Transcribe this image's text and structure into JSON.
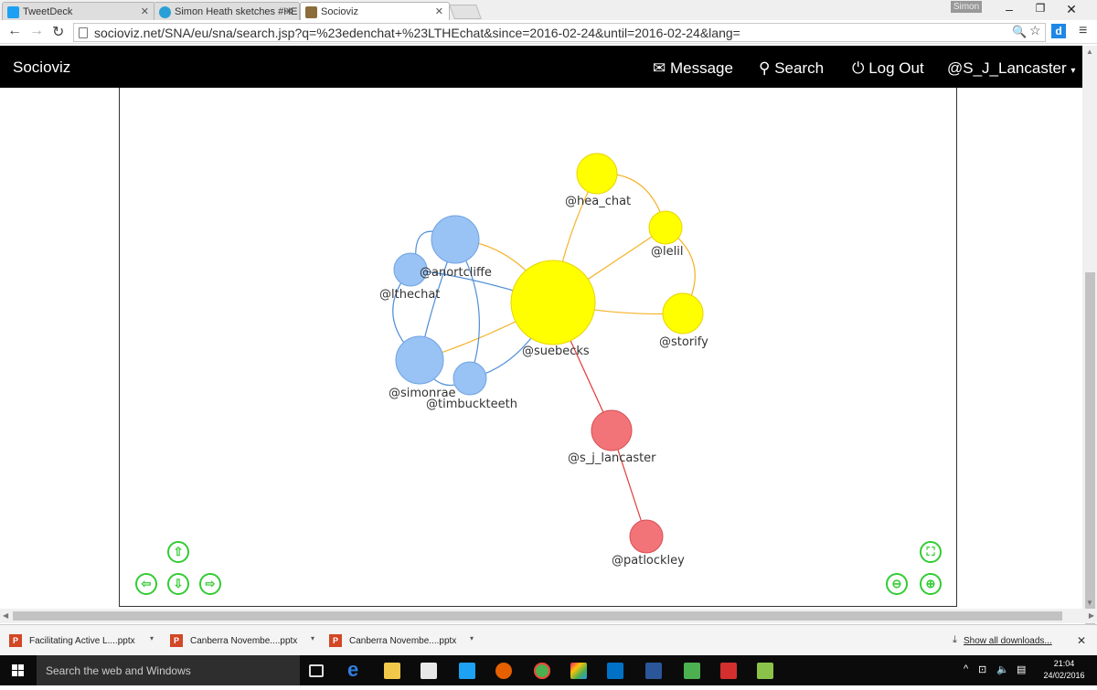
{
  "browser": {
    "tabs": [
      {
        "label": "TweetDeck",
        "color": "#1da1f2"
      },
      {
        "label": "Simon Heath sketches #HE",
        "color": "#2a9fd6"
      },
      {
        "label": "Socioviz",
        "color": "#8a6d3b"
      }
    ],
    "profile_name": "Simon",
    "url": "socioviz.net/SNA/eu/sna/search.jsp?q=%23edenchat+%23LTHEchat&since=2016-02-24&until=2016-02-24&lang="
  },
  "app": {
    "brand": "Socioviz",
    "nav": {
      "message": "Message",
      "search": "Search",
      "logout": "Log Out",
      "user": "@S_J_Lancaster"
    }
  },
  "graph": {
    "nodes": [
      {
        "id": "hea_chat",
        "label": "@hea_chat",
        "color": "#ffff00",
        "group": "yellow"
      },
      {
        "id": "lelil",
        "label": "@lelil",
        "color": "#ffff00",
        "group": "yellow"
      },
      {
        "id": "suebecks",
        "label": "@suebecks",
        "color": "#ffff00",
        "group": "yellow"
      },
      {
        "id": "storify",
        "label": "@storify",
        "color": "#ffff00",
        "group": "yellow"
      },
      {
        "id": "anortcliffe",
        "label": "@anortcliffe",
        "color": "#99c2f5",
        "group": "blue"
      },
      {
        "id": "lthechat",
        "label": "@lthechat",
        "color": "#99c2f5",
        "group": "blue"
      },
      {
        "id": "simonrae",
        "label": "@simonrae",
        "color": "#99c2f5",
        "group": "blue"
      },
      {
        "id": "timbuckteeth",
        "label": "@timbuckteeth",
        "color": "#99c2f5",
        "group": "blue"
      },
      {
        "id": "s_j_lancaster",
        "label": "@s_j_lancaster",
        "color": "#f27478",
        "group": "red"
      },
      {
        "id": "patlockley",
        "label": "@patlockley",
        "color": "#f27478",
        "group": "red"
      }
    ],
    "edge_colors": {
      "yellow": "#f5b32a",
      "blue": "#4f8fd6",
      "red": "#e33b3b"
    }
  },
  "controls": {
    "pan_up": "up-arrow-icon",
    "pan_left": "left-arrow-icon",
    "pan_down": "down-arrow-icon",
    "pan_right": "right-arrow-icon",
    "fit": "fit-screen-icon",
    "zoom_out": "minus-icon",
    "zoom_in": "plus-icon",
    "color": "#33cc33"
  },
  "downloads": {
    "items": [
      "Facilitating Active L....pptx",
      "Canberra Novembe....pptx",
      "Canberra Novembe....pptx"
    ],
    "show_all": "Show all downloads..."
  },
  "taskbar": {
    "search_placeholder": "Search the web and Windows",
    "time": "21:04",
    "date": "24/02/2016"
  }
}
